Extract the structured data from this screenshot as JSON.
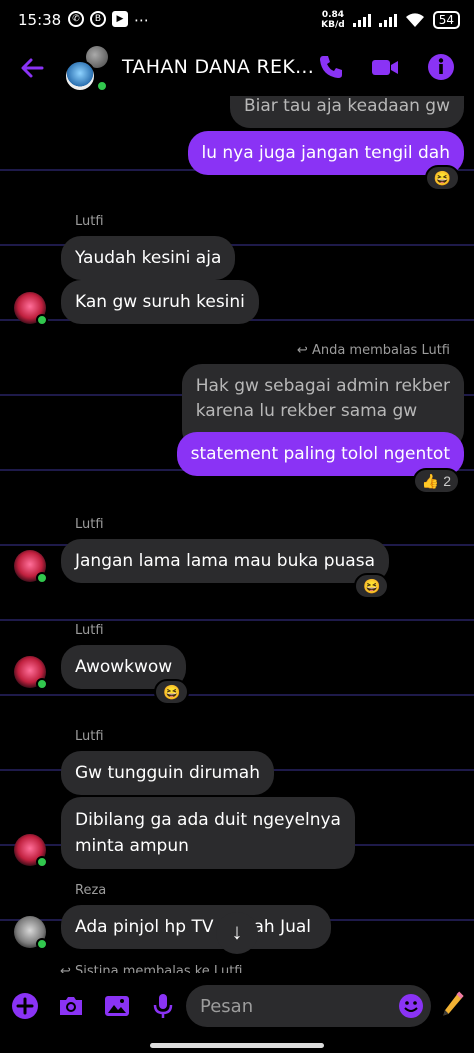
{
  "status": {
    "time": "15:38",
    "net_speed_value": "0.84",
    "net_speed_unit": "KB/d",
    "battery": "54"
  },
  "header": {
    "title": "TAHAN DANA REK...",
    "accent": "#8a33f5"
  },
  "messages": {
    "m1": "Biar tau aja keadaan gw",
    "m2": "lu nya juga jangan tengil dah",
    "m2_reaction": "😆",
    "g1_sender": "Lutfi",
    "m3": "Yaudah kesini aja",
    "m4": "Kan gw suruh kesini",
    "replied_label": "Anda membalas Lutfi",
    "quoted_line1": "Hak gw sebagai admin rekber",
    "quoted_line2": "karena lu rekber sama gw",
    "m5": "statement paling tolol ngentot",
    "m5_reaction_emoji": "👍",
    "m5_reaction_count": "2",
    "g2_sender": "Lutfi",
    "m6": "Jangan lama lama mau buka puasa",
    "m6_reaction": "😆",
    "g3_sender": "Lutfi",
    "m7": "Awowkwow",
    "m7_reaction": "😆",
    "g4_sender": "Lutfi",
    "m8": "Gw tungguin dirumah",
    "m9_line1": "Dibilang ga ada duit ngeyelnya",
    "m9_line2": "minta ampun",
    "g5_sender": "Reza",
    "m10_left": "Ada pinjol hp TV",
    "m10_right": "ah Jual",
    "cut_off": "Sistina membalas ke Lutfi"
  },
  "input": {
    "placeholder": "Pesan"
  }
}
